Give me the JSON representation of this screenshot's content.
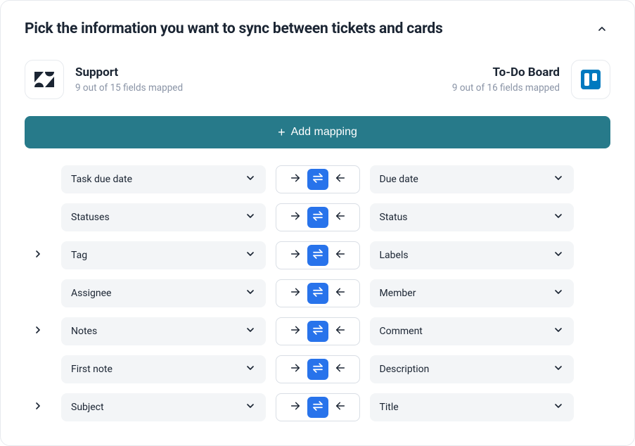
{
  "header": {
    "title": "Pick the information you want to sync between tickets and cards"
  },
  "left_system": {
    "name": "Support",
    "subtitle": "9 out of 15 fields mapped"
  },
  "right_system": {
    "name": "To-Do Board",
    "subtitle": "9 out of 16 fields mapped"
  },
  "add_button": {
    "label": "Add mapping"
  },
  "mappings": [
    {
      "left": "Task due date",
      "right": "Due date",
      "expandable": false
    },
    {
      "left": "Statuses",
      "right": "Status",
      "expandable": false
    },
    {
      "left": "Tag",
      "right": "Labels",
      "expandable": true
    },
    {
      "left": "Assignee",
      "right": "Member",
      "expandable": false
    },
    {
      "left": "Notes",
      "right": "Comment",
      "expandable": true
    },
    {
      "left": "First note",
      "right": "Description",
      "expandable": false
    },
    {
      "left": "Subject",
      "right": "Title",
      "expandable": true
    }
  ]
}
